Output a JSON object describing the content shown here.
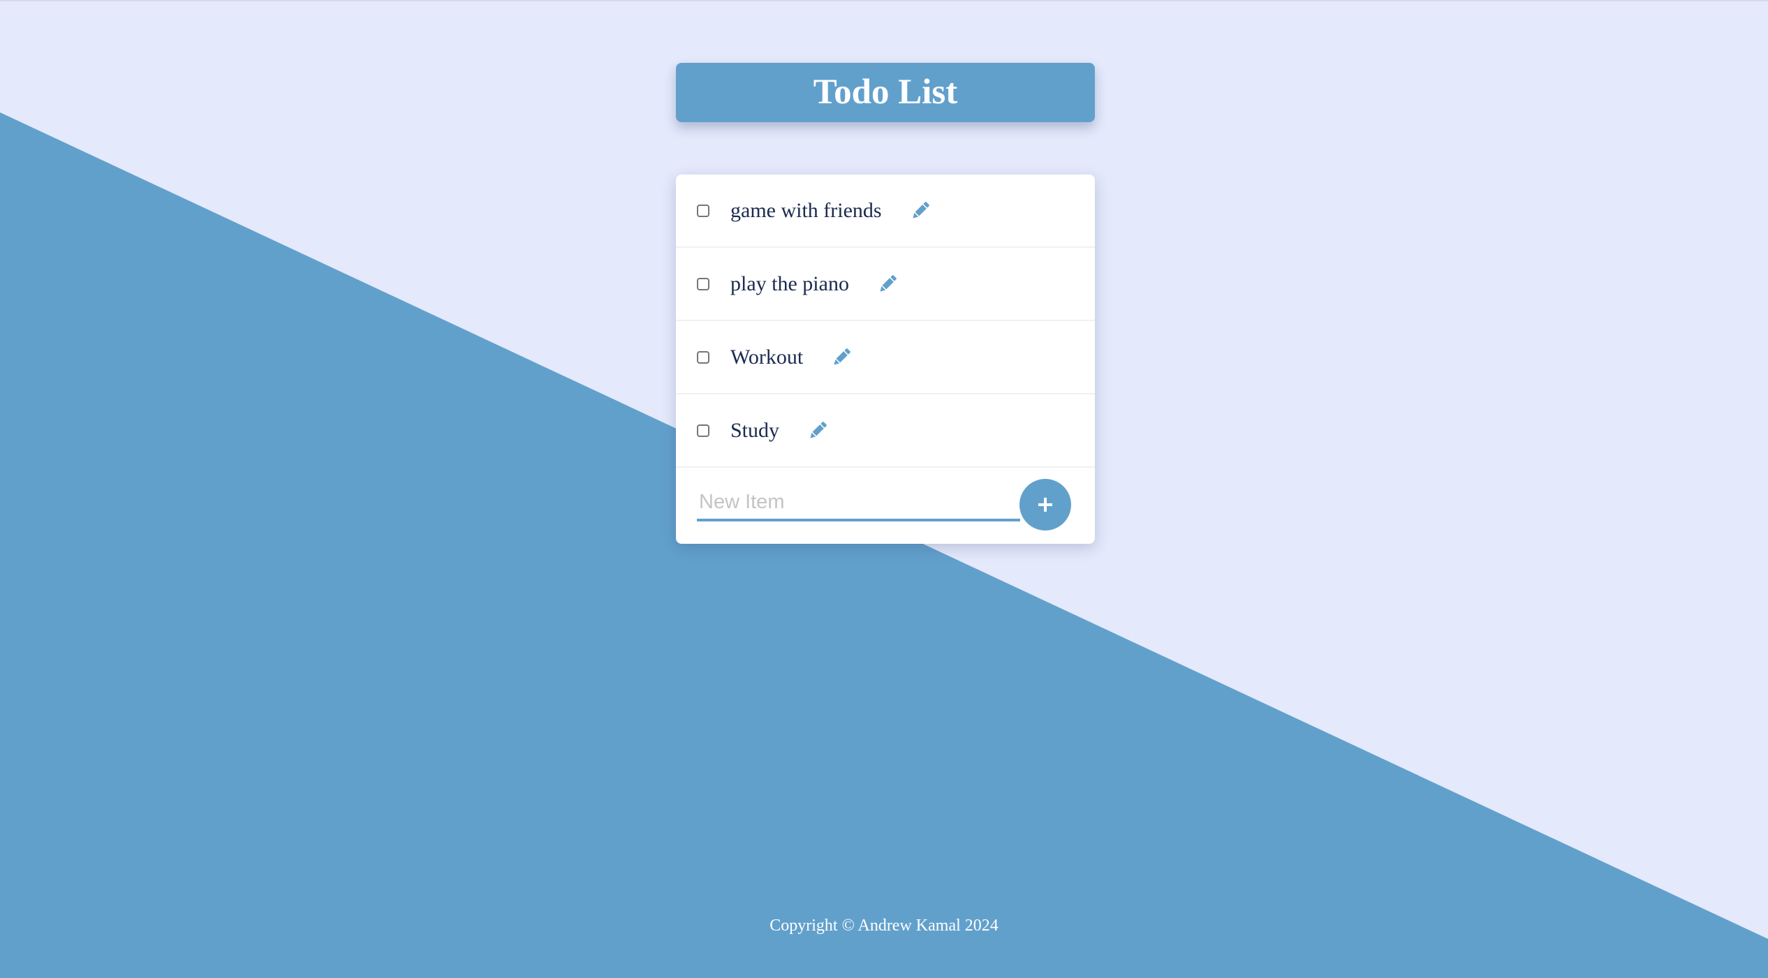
{
  "app": {
    "title": "Todo List"
  },
  "todos": [
    {
      "text": "game with friends",
      "checked": false,
      "edit_icon": "pencil-icon"
    },
    {
      "text": "play the piano",
      "checked": false,
      "edit_icon": "pencil-icon"
    },
    {
      "text": "Workout",
      "checked": false,
      "edit_icon": "pencil-icon"
    },
    {
      "text": "Study",
      "checked": false,
      "edit_icon": "pencil-icon"
    }
  ],
  "new_item": {
    "placeholder": "New Item",
    "value": "",
    "add_icon": "plus-icon"
  },
  "footer": {
    "text": "Copyright © Andrew Kamal 2024"
  },
  "colors": {
    "accent": "#62a0cc",
    "background": "#e4e9fb",
    "text": "#1b2a4e"
  }
}
